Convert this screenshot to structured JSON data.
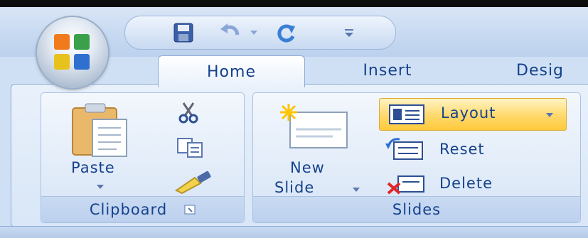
{
  "ribbon": {
    "tabs": [
      {
        "label": "Home",
        "active": true
      },
      {
        "label": "Insert",
        "active": false
      },
      {
        "label": "Desig",
        "active": false
      }
    ],
    "groups": {
      "clipboard": {
        "label": "Clipboard",
        "paste_label": "Paste",
        "buttons": [
          "cut-icon",
          "copy-icon",
          "format-painter-icon"
        ]
      },
      "slides": {
        "label": "Slides",
        "new_slide_line1": "New",
        "new_slide_line2": "Slide",
        "layout_label": "Layout",
        "reset_label": "Reset",
        "delete_label": "Delete"
      }
    }
  },
  "quick_access": [
    "save-icon",
    "undo-icon",
    "redo-icon",
    "customize-icon"
  ],
  "colors": {
    "accent_text": "#15428b",
    "highlight": "#ffd86a"
  }
}
